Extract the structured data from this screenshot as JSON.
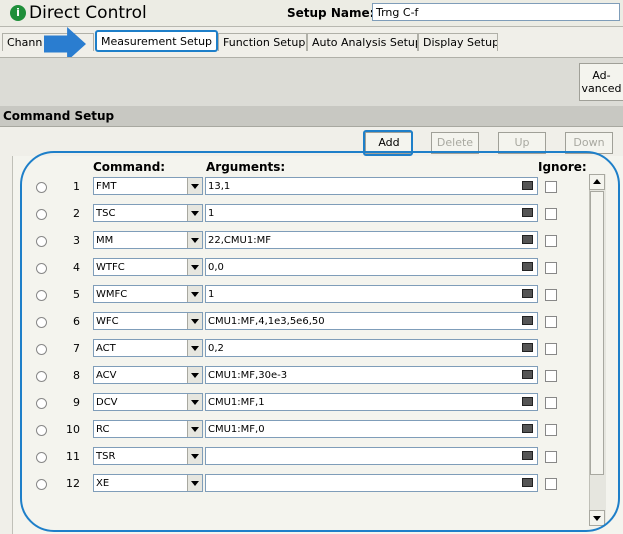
{
  "window": {
    "title": "Direct Control",
    "icon": "info-icon"
  },
  "setup": {
    "label": "Setup Name:",
    "value": "Trng C-f"
  },
  "tabs": [
    {
      "label": "Channel Setup",
      "visible_text": "Chann"
    },
    {
      "label": "Measurement Setup",
      "active": true
    },
    {
      "label": "Function Setup"
    },
    {
      "label": "Auto Analysis Setup"
    },
    {
      "label": "Display Setup"
    }
  ],
  "toolbar": {
    "advanced_label": "Ad-\nvanced"
  },
  "command_setup": {
    "title": "Command Setup",
    "buttons": {
      "add": "Add",
      "delete": "Delete",
      "up": "Up",
      "down": "Down"
    },
    "columns": {
      "command": "Command:",
      "arguments": "Arguments:",
      "ignore": "Ignore:"
    },
    "rows": [
      {
        "num": "1",
        "command": "FMT",
        "arguments": "13,1"
      },
      {
        "num": "2",
        "command": "TSC",
        "arguments": "1"
      },
      {
        "num": "3",
        "command": "MM",
        "arguments": "22,CMU1:MF"
      },
      {
        "num": "4",
        "command": "WTFC",
        "arguments": "0,0"
      },
      {
        "num": "5",
        "command": "WMFC",
        "arguments": "1"
      },
      {
        "num": "6",
        "command": "WFC",
        "arguments": "CMU1:MF,4,1e3,5e6,50"
      },
      {
        "num": "7",
        "command": "ACT",
        "arguments": "0,2"
      },
      {
        "num": "8",
        "command": "ACV",
        "arguments": "CMU1:MF,30e-3"
      },
      {
        "num": "9",
        "command": "DCV",
        "arguments": "CMU1:MF,1"
      },
      {
        "num": "10",
        "command": "RC",
        "arguments": "CMU1:MF,0"
      },
      {
        "num": "11",
        "command": "TSR",
        "arguments": ""
      },
      {
        "num": "12",
        "command": "XE",
        "arguments": ""
      }
    ]
  },
  "colors": {
    "highlight": "#1e7fc9",
    "arrow": "#2a7dd0",
    "app_icon": "#1f8f3a"
  }
}
